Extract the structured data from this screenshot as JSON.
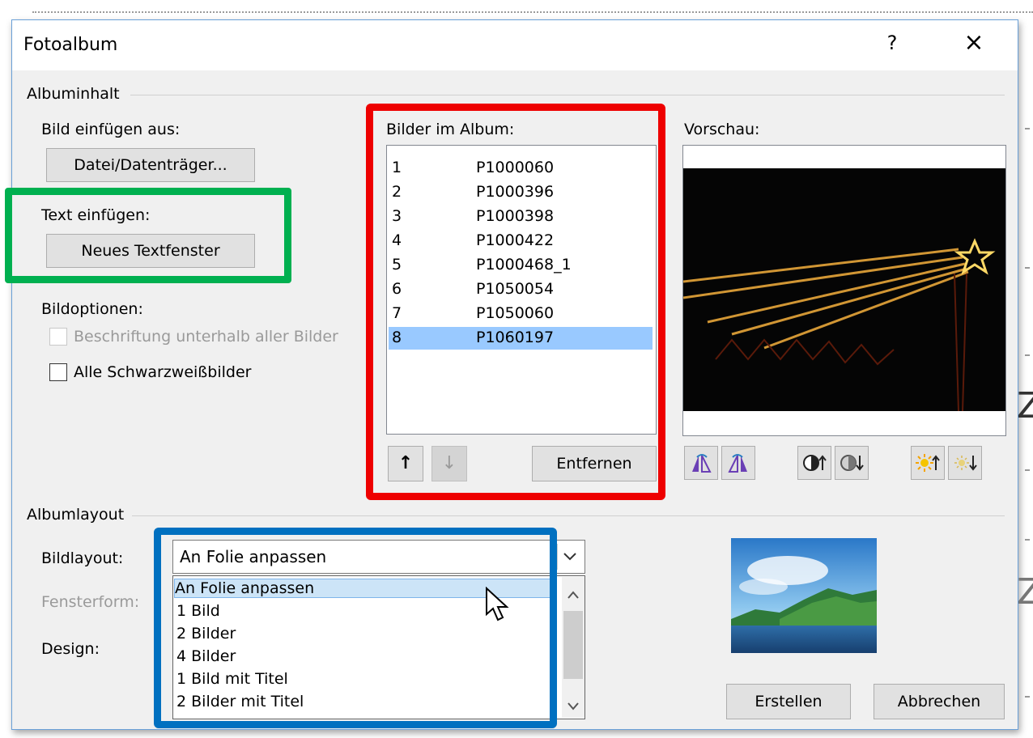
{
  "window": {
    "title": "Fotoalbum",
    "help_glyph": "?",
    "close_glyph": "×"
  },
  "album_content": {
    "group_label": "Albuminhalt",
    "insert_from_label": "Bild einfügen aus:",
    "file_button": "Datei/Datenträger...",
    "insert_text_label": "Text einfügen:",
    "new_textbox_button": "Neues Textfenster",
    "picture_options_label": "Bildoptionen:",
    "captions_checkbox": "Beschriftung unterhalb aller Bilder",
    "captions_checked": false,
    "bw_checkbox": "Alle Schwarzweißbilder",
    "bw_checked": false
  },
  "album_pictures": {
    "label": "Bilder im Album:",
    "items": [
      {
        "num": "1",
        "name": "P1000060"
      },
      {
        "num": "2",
        "name": "P1000396"
      },
      {
        "num": "3",
        "name": "P1000398"
      },
      {
        "num": "4",
        "name": "P1000422"
      },
      {
        "num": "5",
        "name": "P1000468_1"
      },
      {
        "num": "6",
        "name": "P1050054"
      },
      {
        "num": "7",
        "name": "P1050060"
      },
      {
        "num": "8",
        "name": "P1060197"
      }
    ],
    "selected_index": 7,
    "move_up_glyph": "↑",
    "move_down_glyph": "↓",
    "remove_button": "Entfernen"
  },
  "preview": {
    "label": "Vorschau:",
    "tools": [
      {
        "icon": "rotate-left-icon"
      },
      {
        "icon": "rotate-right-icon"
      },
      {
        "icon": "contrast-increase-icon"
      },
      {
        "icon": "contrast-decrease-icon"
      },
      {
        "icon": "brightness-increase-icon"
      },
      {
        "icon": "brightness-decrease-icon"
      }
    ]
  },
  "album_layout": {
    "group_label": "Albumlayout",
    "picture_layout_label": "Bildlayout:",
    "picture_layout_value": "An Folie anpassen",
    "frame_shape_label": "Fensterform:",
    "theme_label": "Design:",
    "dropdown_options": [
      "An Folie anpassen",
      "1 Bild",
      "2 Bilder",
      "4 Bilder",
      "1 Bild mit Titel",
      "2 Bilder mit Titel"
    ],
    "dropdown_selected": 0
  },
  "footer": {
    "create_button": "Erstellen",
    "cancel_button": "Abbrechen"
  },
  "annotation_colors": {
    "red": "#ee0000",
    "green": "#00b050",
    "blue": "#0070c0"
  }
}
